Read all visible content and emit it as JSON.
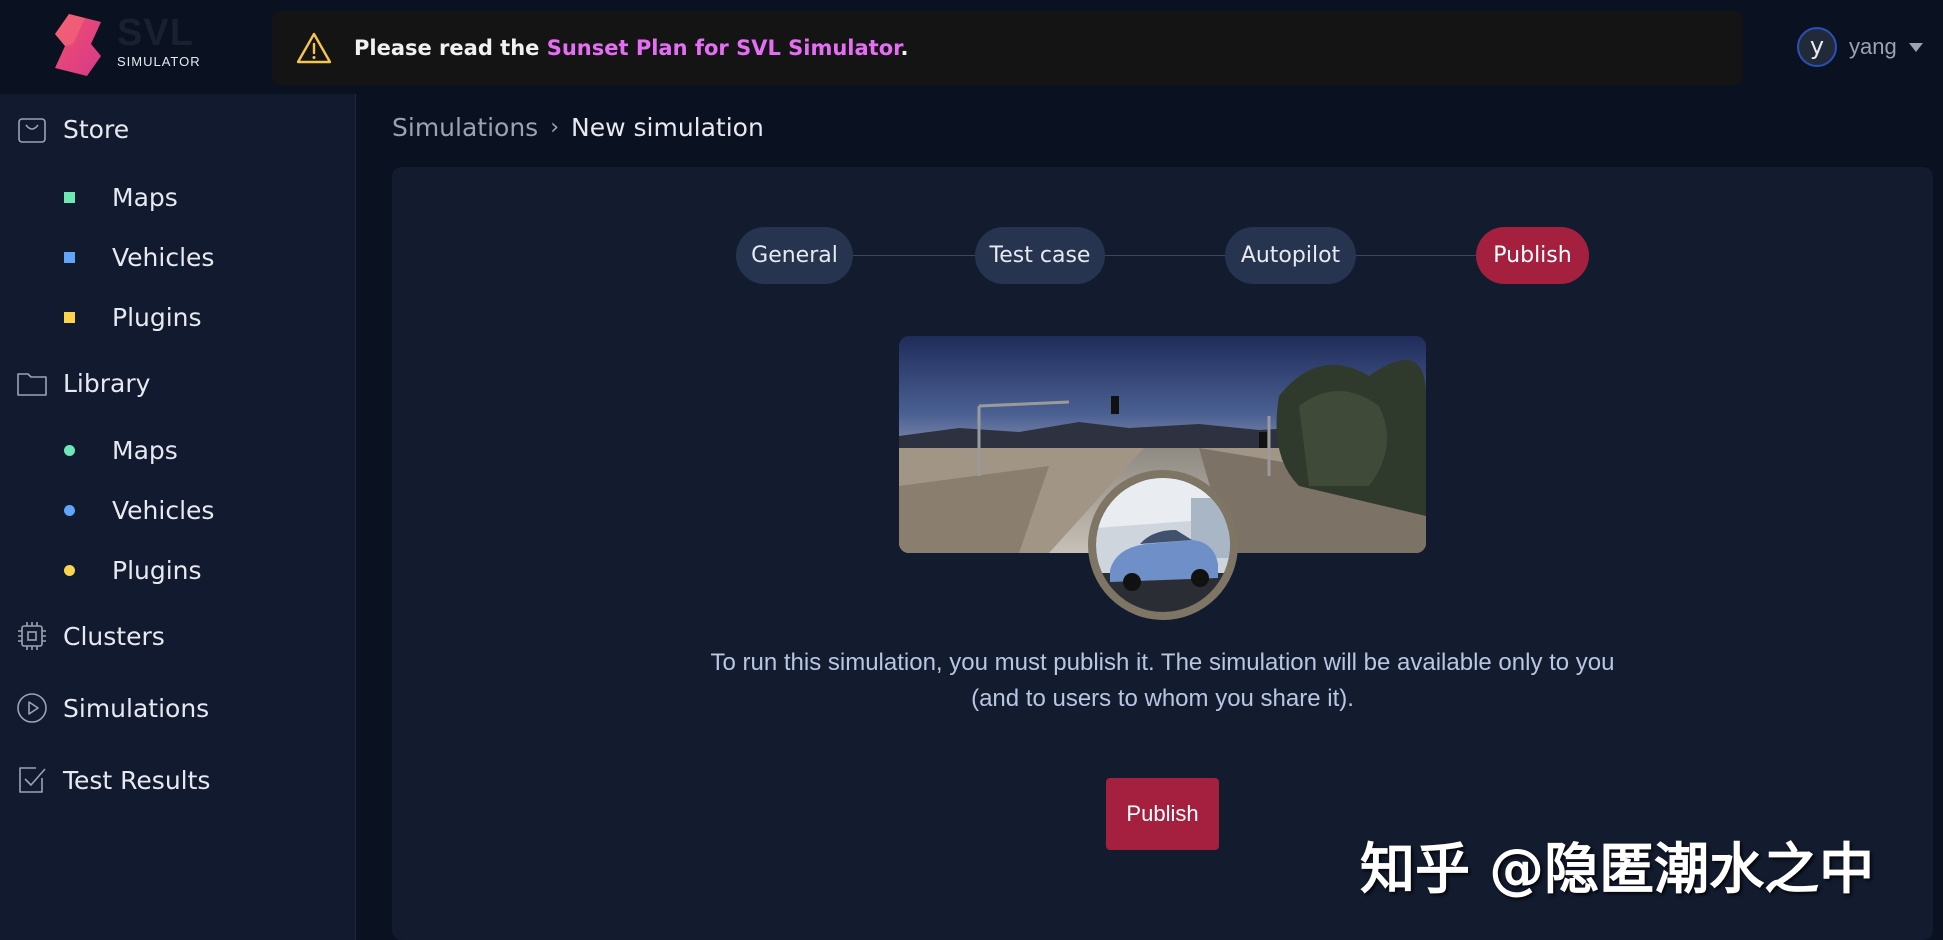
{
  "header": {
    "logo": {
      "word": "SVL",
      "sub": "SIMULATOR"
    },
    "banner": {
      "prefix": "Please read the ",
      "link": "Sunset Plan for SVL Simulator",
      "suffix": "."
    },
    "user": {
      "initial": "y",
      "name": "yang"
    }
  },
  "sidebar": {
    "store": {
      "label": "Store",
      "items": [
        {
          "label": "Maps",
          "color": "#6ee7b7"
        },
        {
          "label": "Vehicles",
          "color": "#60a5fa"
        },
        {
          "label": "Plugins",
          "color": "#fcd34d"
        }
      ]
    },
    "library": {
      "label": "Library",
      "items": [
        {
          "label": "Maps",
          "color": "#6ee7b7"
        },
        {
          "label": "Vehicles",
          "color": "#60a5fa"
        },
        {
          "label": "Plugins",
          "color": "#fcd34d"
        }
      ]
    },
    "clusters": {
      "label": "Clusters"
    },
    "simulations": {
      "label": "Simulations"
    },
    "test_results": {
      "label": "Test Results"
    }
  },
  "breadcrumb": {
    "parent": "Simulations",
    "separator": "›",
    "current": "New simulation"
  },
  "stepper": {
    "steps": [
      {
        "label": "General"
      },
      {
        "label": "Test case"
      },
      {
        "label": "Autopilot"
      },
      {
        "label": "Publish"
      }
    ],
    "active": "Publish"
  },
  "main": {
    "description_line1": "To run this simulation, you must publish it. The simulation will be available only to you",
    "description_line2": "(and to users to whom you share it).",
    "publish_label": "Publish"
  },
  "watermark": "知乎 @隐匿潮水之中",
  "colors": {
    "accent": "#a51f3f",
    "link": "#e66ef5",
    "background": "#0a1120",
    "panel": "#131b2f",
    "step": "#26344f"
  }
}
